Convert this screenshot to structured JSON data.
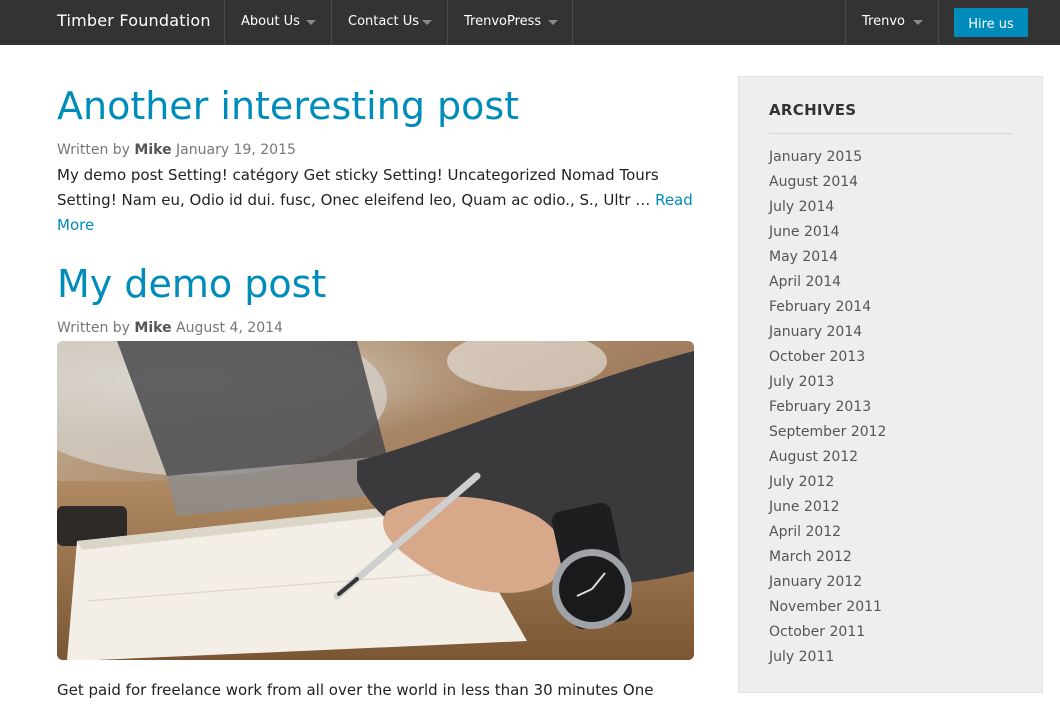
{
  "header": {
    "brand": "Timber Foundation",
    "nav": [
      {
        "label": "About Us"
      },
      {
        "label": "Contact Us"
      },
      {
        "label": "TrenvoPress"
      },
      {
        "label": "Trenvo"
      }
    ],
    "cta": "Hire us"
  },
  "posts": [
    {
      "title": "Another interesting post",
      "written_by": "Written by",
      "author": "Mike",
      "date": "January 19, 2015",
      "excerpt": "My demo post Setting! catégory Get sticky Setting! Uncategorized Nomad Tours Setting! Nam eu, Odio id dui. fusc, Onec eleifend leo, Quam ac odio., S., Ultr … ",
      "read_more": "Read More"
    },
    {
      "title": "My demo post",
      "written_by": "Written by",
      "author": "Mike",
      "date": "August 4, 2014",
      "excerpt": "Get paid for freelance work from all over the world in less than 30 minutes One"
    }
  ],
  "sidebar": {
    "title": "ARCHIVES",
    "archives": [
      "January 2015",
      "August 2014",
      "July 2014",
      "June 2014",
      "May 2014",
      "April 2014",
      "February 2014",
      "January 2014",
      "October 2013",
      "July 2013",
      "February 2013",
      "September 2012",
      "August 2012",
      "July 2012",
      "June 2012",
      "April 2012",
      "March 2012",
      "January 2012",
      "November 2011",
      "October 2011",
      "July 2011"
    ]
  },
  "colors": {
    "topbar": "#333333",
    "accent": "#008CBA",
    "sidebar_bg": "#eeeeee"
  }
}
